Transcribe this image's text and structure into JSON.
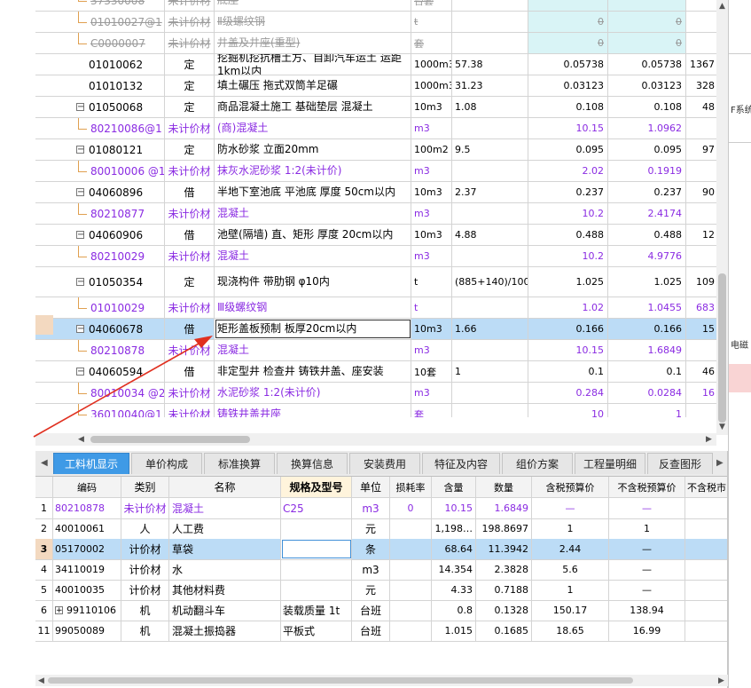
{
  "top_grid": {
    "rows": [
      {
        "code": "37330008",
        "type": "未计价材",
        "name": "底座",
        "unit": "台套",
        "qexp": "",
        "qty": "",
        "total": "",
        "more": "",
        "style": "strike-sub",
        "cyan": true
      },
      {
        "code": "01010027@1",
        "type": "未计价材",
        "name": "Ⅱ级螺纹钢",
        "unit": "t",
        "qexp": "",
        "qty": "0",
        "total": "0",
        "more": "",
        "style": "strike-sub",
        "cyan": true
      },
      {
        "code": "C0000007",
        "type": "未计价材",
        "name": "井盖及井座(重型)",
        "unit": "套",
        "qexp": "",
        "qty": "0",
        "total": "0",
        "more": "",
        "style": "strike-sub",
        "cyan": true
      },
      {
        "code": "01010062",
        "type": "定",
        "name": "挖掘机挖抗槽土方、自卸汽车运土 运距1km以内",
        "unit": "1000m3",
        "qexp": "57.38",
        "qty": "0.05738",
        "total": "0.05738",
        "more": "1367",
        "style": "main"
      },
      {
        "code": "01010132",
        "type": "定",
        "name": "填土碾压 拖式双筒羊足碾",
        "unit": "1000m3",
        "qexp": "31.23",
        "qty": "0.03123",
        "total": "0.03123",
        "more": "328",
        "style": "main"
      },
      {
        "code": "01050068",
        "type": "定",
        "name": "商品混凝土施工 基础垫层 混凝土",
        "unit": "10m3",
        "qexp": "1.08",
        "qty": "0.108",
        "total": "0.108",
        "more": "48",
        "style": "main",
        "minus": true
      },
      {
        "code": "80210086@1",
        "type": "未计价材",
        "name": "(商)混凝土",
        "unit": "m3",
        "qexp": "",
        "qty": "10.15",
        "total": "1.0962",
        "more": "",
        "style": "sub"
      },
      {
        "code": "01080121",
        "type": "定",
        "name": "防水砂浆 立面20mm",
        "unit": "100m2",
        "qexp": "9.5",
        "qty": "0.095",
        "total": "0.095",
        "more": "97",
        "style": "main",
        "minus": true
      },
      {
        "code": "80010006  @1",
        "type": "未计价材",
        "name": "抹灰水泥砂浆 1:2(未计价)",
        "unit": "m3",
        "qexp": "",
        "qty": "2.02",
        "total": "0.1919",
        "more": "",
        "style": "sub"
      },
      {
        "code": "04060896",
        "type": "借",
        "name": "半地下室池底 平池底 厚度 50cm以内",
        "unit": "10m3",
        "qexp": "2.37",
        "qty": "0.237",
        "total": "0.237",
        "more": "90",
        "style": "main",
        "minus": true
      },
      {
        "code": "80210877",
        "type": "未计价材",
        "name": "混凝土",
        "unit": "m3",
        "qexp": "",
        "qty": "10.2",
        "total": "2.4174",
        "more": "",
        "style": "sub"
      },
      {
        "code": "04060906",
        "type": "借",
        "name": "池壁(隔墙) 直、矩形 厚度 20cm以内",
        "unit": "10m3",
        "qexp": "4.88",
        "qty": "0.488",
        "total": "0.488",
        "more": "12",
        "style": "main",
        "minus": true
      },
      {
        "code": "80210029",
        "type": "未计价材",
        "name": "混凝土",
        "unit": "m3",
        "qexp": "",
        "qty": "10.2",
        "total": "4.9776",
        "more": "",
        "style": "sub"
      },
      {
        "code": "01050354",
        "type": "定",
        "name": "现浇构件 带肋钢 φ10内",
        "unit": "t",
        "qexp": "(885+140)/1000",
        "qty": "1.025",
        "total": "1.025",
        "more": "109",
        "style": "main",
        "minus": true,
        "tall": true
      },
      {
        "code": "01010029",
        "type": "未计价材",
        "name": "Ⅲ级螺纹钢",
        "unit": "t",
        "qexp": "",
        "qty": "1.02",
        "total": "1.0455",
        "more": "683",
        "style": "sub"
      },
      {
        "code": "04060678",
        "type": "借",
        "name": "矩形盖板预制 板厚20cm以内",
        "unit": "10m3",
        "qexp": "1.66",
        "qty": "0.166",
        "total": "0.166",
        "more": "15",
        "style": "main",
        "minus": true,
        "selected": true
      },
      {
        "code": "80210878",
        "type": "未计价材",
        "name": "混凝土",
        "unit": "m3",
        "qexp": "",
        "qty": "10.15",
        "total": "1.6849",
        "more": "",
        "style": "sub"
      },
      {
        "code": "04060594",
        "type": "借",
        "name": "非定型井 检查井 铸铁井盖、座安装",
        "unit": "10套",
        "qexp": "1",
        "qty": "0.1",
        "total": "0.1",
        "more": "46",
        "style": "main",
        "minus": true
      },
      {
        "code": "80010034  @2",
        "type": "未计价材",
        "name": "水泥砂浆 1:2(未计价)",
        "unit": "m3",
        "qexp": "",
        "qty": "0.284",
        "total": "0.0284",
        "more": "16",
        "style": "sub"
      },
      {
        "code": "36010040@1",
        "type": "未计价材",
        "name": "铸铁井盖井座",
        "unit": "套",
        "qexp": "",
        "qty": "10",
        "total": "1",
        "more": "",
        "style": "sub"
      }
    ]
  },
  "tabs": [
    "工料机显示",
    "单价构成",
    "标准换算",
    "换算信息",
    "安装费用",
    "特征及内容",
    "组价方案",
    "工程量明细",
    "反查图形"
  ],
  "bottom_grid": {
    "headers": [
      "编码",
      "类别",
      "名称",
      "规格及型号",
      "单位",
      "损耗率",
      "含量",
      "数量",
      "含税预算价",
      "不含税预算价",
      "不含税市"
    ],
    "rows": [
      {
        "idx": "1",
        "code": "80210878",
        "cat": "未计价材",
        "name": "混凝土",
        "spec": "C25",
        "unit": "m3",
        "loss": "0",
        "cnt": "10.15",
        "qty": "1.6849",
        "tax": "—",
        "ntax": "—",
        "more": "",
        "purple": true
      },
      {
        "idx": "2",
        "code": "40010061",
        "cat": "人",
        "name": "人工费",
        "spec": "",
        "unit": "元",
        "loss": "",
        "cnt": "1,198…",
        "qty": "198.8697",
        "tax": "1",
        "ntax": "1",
        "more": ""
      },
      {
        "idx": "3",
        "code": "05170002",
        "cat": "计价材",
        "name": "草袋",
        "spec": "",
        "unit": "条",
        "loss": "",
        "cnt": "68.64",
        "qty": "11.3942",
        "tax": "2.44",
        "ntax": "—",
        "more": "",
        "selected": true
      },
      {
        "idx": "4",
        "code": "34110019",
        "cat": "计价材",
        "name": "水",
        "spec": "",
        "unit": "m3",
        "loss": "",
        "cnt": "14.354",
        "qty": "2.3828",
        "tax": "5.6",
        "ntax": "—",
        "more": ""
      },
      {
        "idx": "5",
        "code": "40010035",
        "cat": "计价材",
        "name": "其他材料费",
        "spec": "",
        "unit": "元",
        "loss": "",
        "cnt": "4.33",
        "qty": "0.7188",
        "tax": "1",
        "ntax": "—",
        "more": ""
      },
      {
        "idx": "6",
        "code": "99110106",
        "cat": "机",
        "name": "机动翻斗车",
        "spec": "装载质量 1t",
        "unit": "台班",
        "loss": "",
        "cnt": "0.8",
        "qty": "0.1328",
        "tax": "150.17",
        "ntax": "138.94",
        "more": "",
        "plus": true
      },
      {
        "idx": "11",
        "code": "99050089",
        "cat": "机",
        "name": "混凝土振捣器",
        "spec": "平板式",
        "unit": "台班",
        "loss": "",
        "cnt": "1.015",
        "qty": "0.1685",
        "tax": "18.65",
        "ntax": "16.99",
        "more": ""
      }
    ]
  },
  "right_panel": {
    "label1": "F系统",
    "label2": "电磁"
  },
  "colors": {
    "accent": "#3f9ae6",
    "selected_row": "#bcdcf6",
    "purple_text": "#8a2be2",
    "cyan_cell": "#d9f4f6",
    "marker": "#f3d9c0",
    "annotation_arrow": "#e03020"
  }
}
